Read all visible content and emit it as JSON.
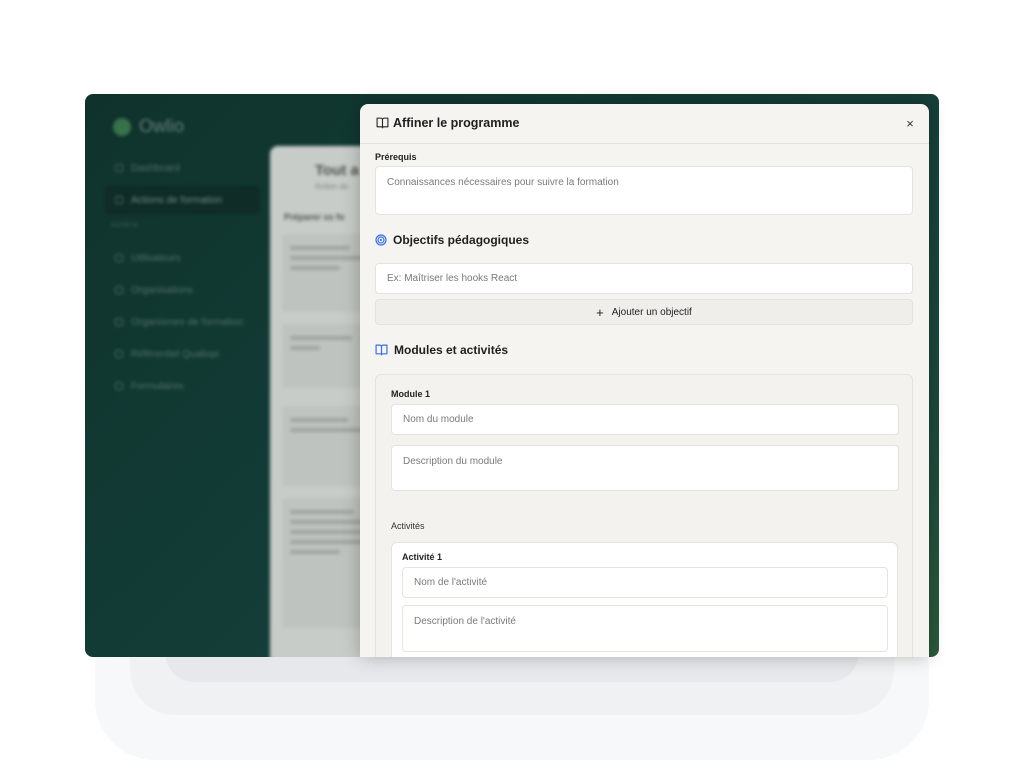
{
  "background_app": {
    "logo": "Owlio",
    "nav_items": [
      "Dashboard",
      "Actions de formation"
    ],
    "nav_group": "ADMIN",
    "admin_items": [
      "Utilisateurs",
      "Organisations",
      "Organismes de formation",
      "Référentiel Qualiopi",
      "Formulaires"
    ],
    "panel_title": "Tout a",
    "panel_subtitle": "Action de",
    "panel_heading": "Préparer ss fo"
  },
  "modal": {
    "title": "Affiner le programme",
    "close_label": "×",
    "prerequis": {
      "label": "Prérequis",
      "placeholder": "Connaissances nécessaires pour suivre la formation"
    },
    "objectifs": {
      "title": "Objectifs pédagogiques",
      "input_placeholder": "Ex: Maîtriser les hooks React",
      "add_label": "Ajouter un objectif"
    },
    "modules": {
      "title": "Modules et activités",
      "module": {
        "label": "Module 1",
        "name_placeholder": "Nom du module",
        "description_placeholder": "Description du module",
        "activities_label": "Activités",
        "activity": {
          "label": "Activité 1",
          "name_placeholder": "Nom de l'activité",
          "description_placeholder": "Description de l'activité"
        }
      }
    }
  },
  "colors": {
    "accent_target": "#3b6fe0",
    "accent_book": "#3b6fe0",
    "modal_bg": "#f5f4f0"
  }
}
